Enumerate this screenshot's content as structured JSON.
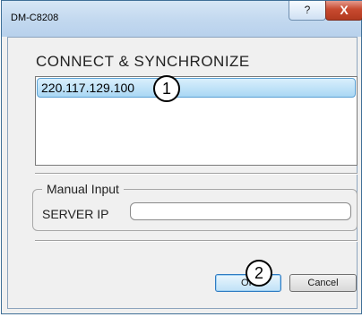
{
  "window": {
    "title": "DM-C8208",
    "help_glyph": "?",
    "close_glyph": "X"
  },
  "dialog": {
    "heading": "CONNECT & SYNCHRONIZE",
    "server_list": [
      "220.117.129.100"
    ],
    "manual_input": {
      "legend": "Manual Input",
      "server_ip_label": "SERVER IP",
      "server_ip_value": ""
    },
    "buttons": {
      "ok": "OK",
      "cancel": "Cancel"
    }
  },
  "callouts": [
    "1",
    "2"
  ]
}
